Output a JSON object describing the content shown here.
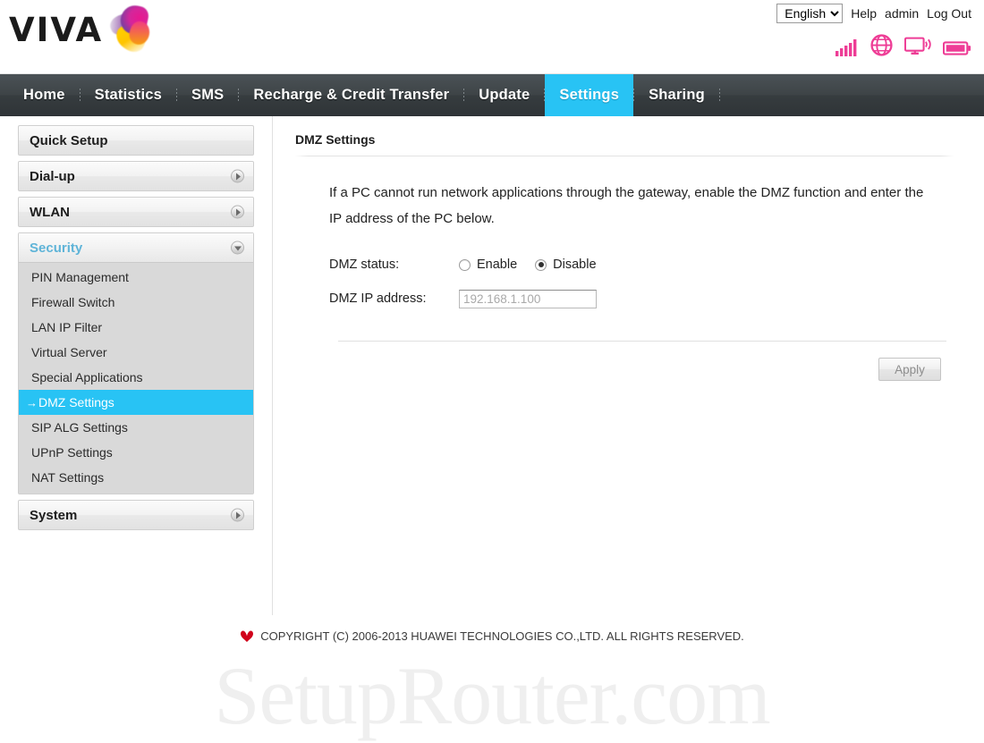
{
  "header": {
    "brand": "VIVA",
    "brand_icon": "viva-butterfly-logo",
    "language_value": "English",
    "language_options": [
      "English"
    ],
    "help_label": "Help",
    "user_label": "admin",
    "logout_label": "Log Out",
    "status_icons": [
      {
        "name": "signal-bars-icon",
        "color": "#ee3d96"
      },
      {
        "name": "globe-icon",
        "color": "#ee3d96"
      },
      {
        "name": "monitor-wifi-icon",
        "color": "#ee3d96"
      },
      {
        "name": "battery-icon",
        "color": "#ee3d96"
      }
    ]
  },
  "nav": {
    "active": "Settings",
    "active_color": "#28c3f4",
    "items": [
      {
        "label": "Home"
      },
      {
        "label": "Statistics"
      },
      {
        "label": "SMS"
      },
      {
        "label": "Recharge & Credit Transfer"
      },
      {
        "label": "Update"
      },
      {
        "label": "Settings"
      },
      {
        "label": "Sharing"
      }
    ]
  },
  "sidebar": {
    "selected": "DMZ Settings",
    "selected_color": "#28c3f4",
    "groups": [
      {
        "label": "Quick Setup",
        "expandable": false,
        "open": false,
        "items": []
      },
      {
        "label": "Dial-up",
        "expandable": true,
        "open": false,
        "items": []
      },
      {
        "label": "WLAN",
        "expandable": true,
        "open": false,
        "items": []
      },
      {
        "label": "Security",
        "expandable": true,
        "open": true,
        "items": [
          {
            "label": "PIN Management"
          },
          {
            "label": "Firewall Switch"
          },
          {
            "label": "LAN IP Filter"
          },
          {
            "label": "Virtual Server"
          },
          {
            "label": "Special Applications"
          },
          {
            "label": "DMZ Settings"
          },
          {
            "label": "SIP ALG Settings"
          },
          {
            "label": "UPnP Settings"
          },
          {
            "label": "NAT Settings"
          }
        ]
      },
      {
        "label": "System",
        "expandable": true,
        "open": false,
        "items": []
      }
    ],
    "selected_prefix": "→"
  },
  "content": {
    "title": "DMZ Settings",
    "intro": "If a PC cannot run network applications through the gateway, enable the DMZ function and enter the IP address of the PC below.",
    "status_label": "DMZ status:",
    "status_options": [
      {
        "label": "Enable",
        "checked": false
      },
      {
        "label": "Disable",
        "checked": true
      }
    ],
    "ip_label": "DMZ IP address:",
    "ip_value": "192.168.1.100",
    "apply_label": "Apply"
  },
  "watermark": {
    "text": "SetupRouter.com"
  },
  "footer": {
    "logo_icon": "huawei-flower-icon",
    "logo_color": "#d0021b",
    "copyright": "COPYRIGHT (C) 2006-2013 HUAWEI TECHNOLOGIES CO.,LTD. ALL RIGHTS RESERVED."
  }
}
